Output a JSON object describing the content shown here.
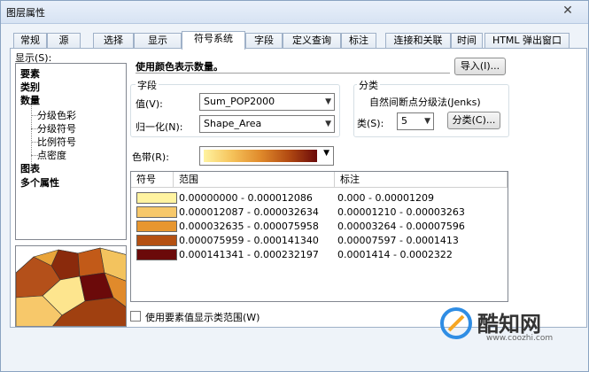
{
  "window": {
    "title": "图层属性"
  },
  "tabs": [
    {
      "label": "常规"
    },
    {
      "label": "源"
    },
    {
      "label": "选择"
    },
    {
      "label": "显示"
    },
    {
      "label": "符号系统"
    },
    {
      "label": "字段"
    },
    {
      "label": "定义查询"
    },
    {
      "label": "标注"
    },
    {
      "label": "连接和关联"
    },
    {
      "label": "时间"
    },
    {
      "label": "HTML 弹出窗口"
    }
  ],
  "active_tab": "符号系统",
  "show": {
    "label": "显示(S):",
    "items": [
      {
        "label": "要素"
      },
      {
        "label": "类别"
      },
      {
        "label": "数量"
      },
      {
        "label": "分级色彩"
      },
      {
        "label": "分级符号"
      },
      {
        "label": "比例符号"
      },
      {
        "label": "点密度"
      },
      {
        "label": "图表"
      },
      {
        "label": "多个属性"
      }
    ]
  },
  "description": "使用颜色表示数量。",
  "import_button": "导入(I)...",
  "fields": {
    "group_title": "字段",
    "value_label": "值(V):",
    "value": "Sum_POP2000",
    "normalization_label": "归一化(N):",
    "normalization": "Shape_Area"
  },
  "classification": {
    "group_title": "分类",
    "method": "自然间断点分级法(Jenks)",
    "classes_label": "类(S):",
    "classes": "5",
    "classify_button": "分类(C)..."
  },
  "color_ramp_label": "色带(R):",
  "table": {
    "headers": {
      "symbol": "符号",
      "range": "范围",
      "label": "标注"
    },
    "rows": [
      {
        "color": "#fff3a0",
        "range": "0.00000000 - 0.000012086",
        "label": "0.000 - 0.00001209"
      },
      {
        "color": "#f7c86a",
        "range": "0.000012087 - 0.000032634",
        "label": "0.00001210 - 0.00003263"
      },
      {
        "color": "#e7962f",
        "range": "0.000032635 - 0.000075958",
        "label": "0.00003264 - 0.00007596"
      },
      {
        "color": "#b45012",
        "range": "0.000075959 - 0.000141340",
        "label": "0.00007597 - 0.0001413"
      },
      {
        "color": "#6b0a0a",
        "range": "0.000141341 - 0.000232197",
        "label": "0.0001414 - 0.0002322"
      }
    ]
  },
  "show_range_checkbox": {
    "label": "使用要素值显示类范围(W)",
    "checked": false
  },
  "watermark": {
    "brand": "酷知网",
    "url": "www.coozhi.com"
  }
}
